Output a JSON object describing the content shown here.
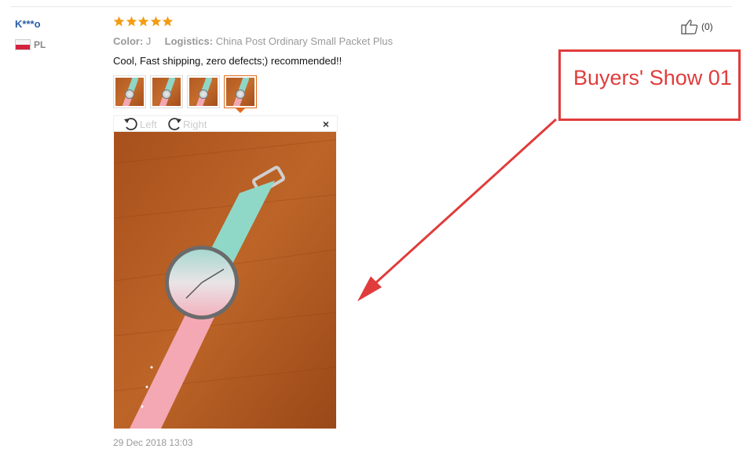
{
  "review": {
    "user": "K***o",
    "country": "PL",
    "rating": 5,
    "color_label": "Color:",
    "color_value": "J",
    "logistics_label": "Logistics:",
    "logistics_value": "China Post Ordinary Small Packet Plus",
    "feedback": "Cool, Fast shipping, zero defects;) recommended!!",
    "date": "29 Dec 2018 13:03",
    "helpful_count": "(0)"
  },
  "viewer": {
    "rotate_left": "Left",
    "rotate_right": "Right",
    "close": "×"
  },
  "annotation": {
    "label": "Buyers' Show 01",
    "color": "#e03c3c"
  },
  "colors": {
    "star": "#f39c12",
    "username": "#2a5ea8",
    "active_thumb": "#e36a1b"
  },
  "icons": {
    "stars": "star-icon",
    "helpful": "thumbs-up-icon",
    "rotate_left": "rotate-left-icon",
    "rotate_right": "rotate-right-icon",
    "close": "close-icon",
    "flag": "poland-flag-icon"
  }
}
